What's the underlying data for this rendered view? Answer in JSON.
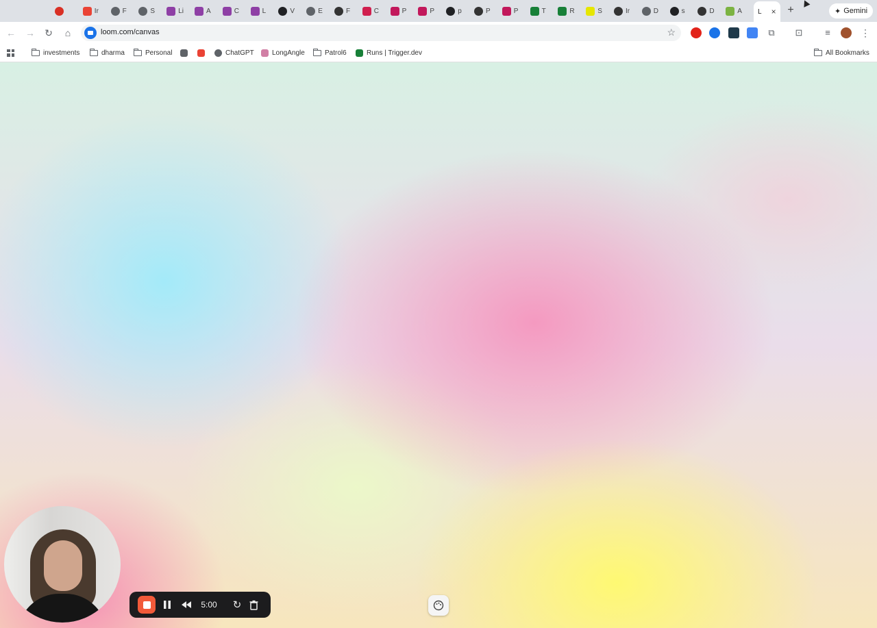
{
  "tabs": [
    {
      "initial": "",
      "color": "#d93025",
      "icon": "record-icon"
    },
    {
      "initial": "Ir",
      "color": "#ea4335",
      "icon": "gmail-icon"
    },
    {
      "initial": "F",
      "color": "#5f6368",
      "icon": "openai-icon"
    },
    {
      "initial": "S",
      "color": "#5f6368",
      "icon": "openai-icon"
    },
    {
      "initial": "Li",
      "color": "#8e3fa5",
      "icon": "linear-icon"
    },
    {
      "initial": "A",
      "color": "#8e3fa5",
      "icon": "linear-icon"
    },
    {
      "initial": "C",
      "color": "#8e3fa5",
      "icon": "linear-icon"
    },
    {
      "initial": "L",
      "color": "#8e3fa5",
      "icon": "linear-icon"
    },
    {
      "initial": "V",
      "color": "#202124",
      "icon": "github-icon"
    },
    {
      "initial": "E",
      "color": "#5f6368",
      "icon": "openai-icon"
    },
    {
      "initial": "F",
      "color": "#333333",
      "icon": "circular-icon"
    },
    {
      "initial": "C",
      "color": "#d01f4e",
      "icon": "app-icon"
    },
    {
      "initial": "P",
      "color": "#c2185b",
      "icon": "shield-icon"
    },
    {
      "initial": "P",
      "color": "#c2185b",
      "icon": "shield-icon"
    },
    {
      "initial": "p",
      "color": "#202124",
      "icon": "github-icon"
    },
    {
      "initial": "P",
      "color": "#333333",
      "icon": "circular-icon"
    },
    {
      "initial": "P",
      "color": "#c2185b",
      "icon": "shield-icon"
    },
    {
      "initial": "T",
      "color": "#188038",
      "icon": "trigger-icon"
    },
    {
      "initial": "R",
      "color": "#188038",
      "icon": "trigger-icon"
    },
    {
      "initial": "S",
      "color": "#e6e600",
      "icon": "infinity-icon"
    },
    {
      "initial": "Ir",
      "color": "#333333",
      "icon": "circular-icon"
    },
    {
      "initial": "D",
      "color": "#5f6368",
      "icon": "openai-icon"
    },
    {
      "initial": "s",
      "color": "#202124",
      "icon": "github-icon"
    },
    {
      "initial": "D",
      "color": "#333333",
      "icon": "circular-icon"
    },
    {
      "initial": "A",
      "color": "#7cb342",
      "icon": "android-icon"
    }
  ],
  "active_tab": {
    "initial": "L",
    "close": "×"
  },
  "new_tab": "+",
  "gemini": {
    "label": "Gemini",
    "icon": "✦"
  },
  "omnibox": {
    "url": "loom.com/canvas"
  },
  "bookmarks": [
    {
      "label": "investments",
      "icon": "folder-icon"
    },
    {
      "label": "dharma",
      "icon": "folder-icon"
    },
    {
      "label": "Personal",
      "icon": "folder-icon"
    },
    {
      "label": "",
      "icon": "puzzle-icon"
    },
    {
      "label": "",
      "icon": "gmail-icon"
    },
    {
      "label": "ChatGPT",
      "icon": "openai-icon"
    },
    {
      "label": "LongAngle",
      "icon": "longangle-icon"
    },
    {
      "label": "Patrol6",
      "icon": "folder-icon"
    },
    {
      "label": "Runs | Trigger.dev",
      "icon": "trigger-icon"
    }
  ],
  "all_bookmarks": "All Bookmarks",
  "recorder": {
    "timer": "5:00"
  },
  "colors": {
    "accent_stop": "#f25a3a",
    "chrome_tabstrip": "#dee1e6",
    "toolbar_bg": "#1c1c1e"
  }
}
